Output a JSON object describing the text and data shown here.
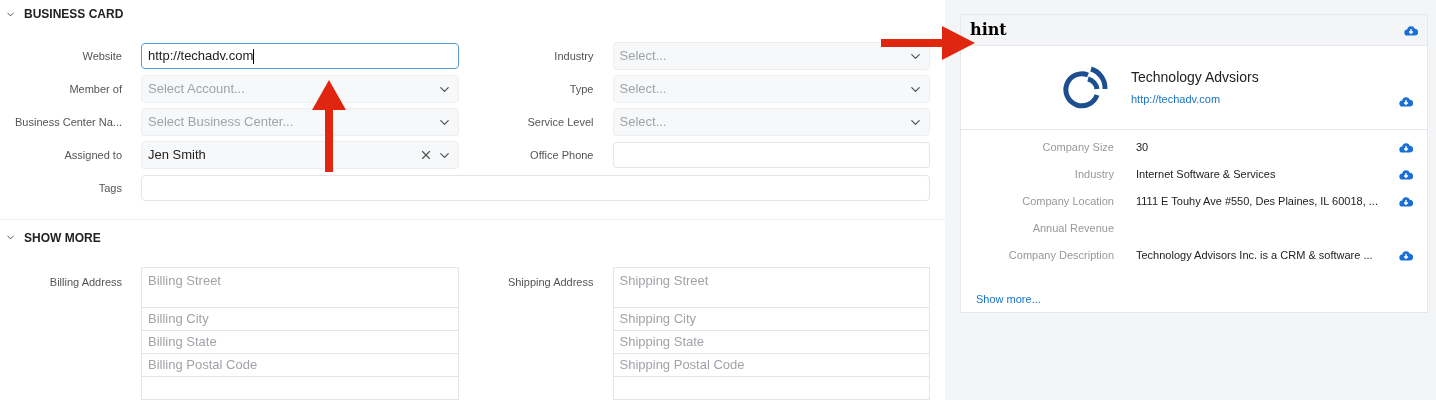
{
  "business_card": {
    "title": "BUSINESS CARD",
    "expanded": true,
    "left_fields": [
      {
        "label": "Website",
        "kind": "input",
        "value": "http://techadv.com",
        "focused": true
      },
      {
        "label": "Member of",
        "kind": "select",
        "placeholder": "Select Account..."
      },
      {
        "label": "Business Center Na...",
        "kind": "select",
        "placeholder": "Select Business Center..."
      },
      {
        "label": "Assigned to",
        "kind": "select",
        "value": "Jen Smith",
        "clearable": true
      }
    ],
    "right_fields": [
      {
        "label": "Industry",
        "kind": "select",
        "placeholder": "Select..."
      },
      {
        "label": "Type",
        "kind": "select",
        "placeholder": "Select..."
      },
      {
        "label": "Service Level",
        "kind": "select",
        "placeholder": "Select..."
      },
      {
        "label": "Office Phone",
        "kind": "input",
        "focused": false
      }
    ],
    "tags": {
      "label": "Tags"
    }
  },
  "show_more": {
    "title": "SHOW MORE",
    "expanded": true,
    "billing": {
      "label": "Billing Address",
      "fields": [
        "Billing Street",
        "Billing City",
        "Billing State",
        "Billing Postal Code"
      ]
    },
    "shipping": {
      "label": "Shipping Address",
      "fields": [
        "Shipping Street",
        "Shipping City",
        "Shipping State",
        "Shipping Postal Code"
      ]
    }
  },
  "hint_panel": {
    "logo": "hint",
    "company_name": "Technology Advsiors",
    "company_url": "http://techadv.com",
    "rows": [
      {
        "label": "Company Size",
        "value": "30"
      },
      {
        "label": "Industry",
        "value": "Internet Software & Services"
      },
      {
        "label": "Company Location",
        "value": "1111 E Touhy Ave #550, Des Plaines, IL 60018, ..."
      },
      {
        "label": "Annual Revenue"
      },
      {
        "label": "Company Description",
        "value": "Technology Advisors Inc. is a CRM & software ..."
      }
    ],
    "show_more": "Show more..."
  }
}
